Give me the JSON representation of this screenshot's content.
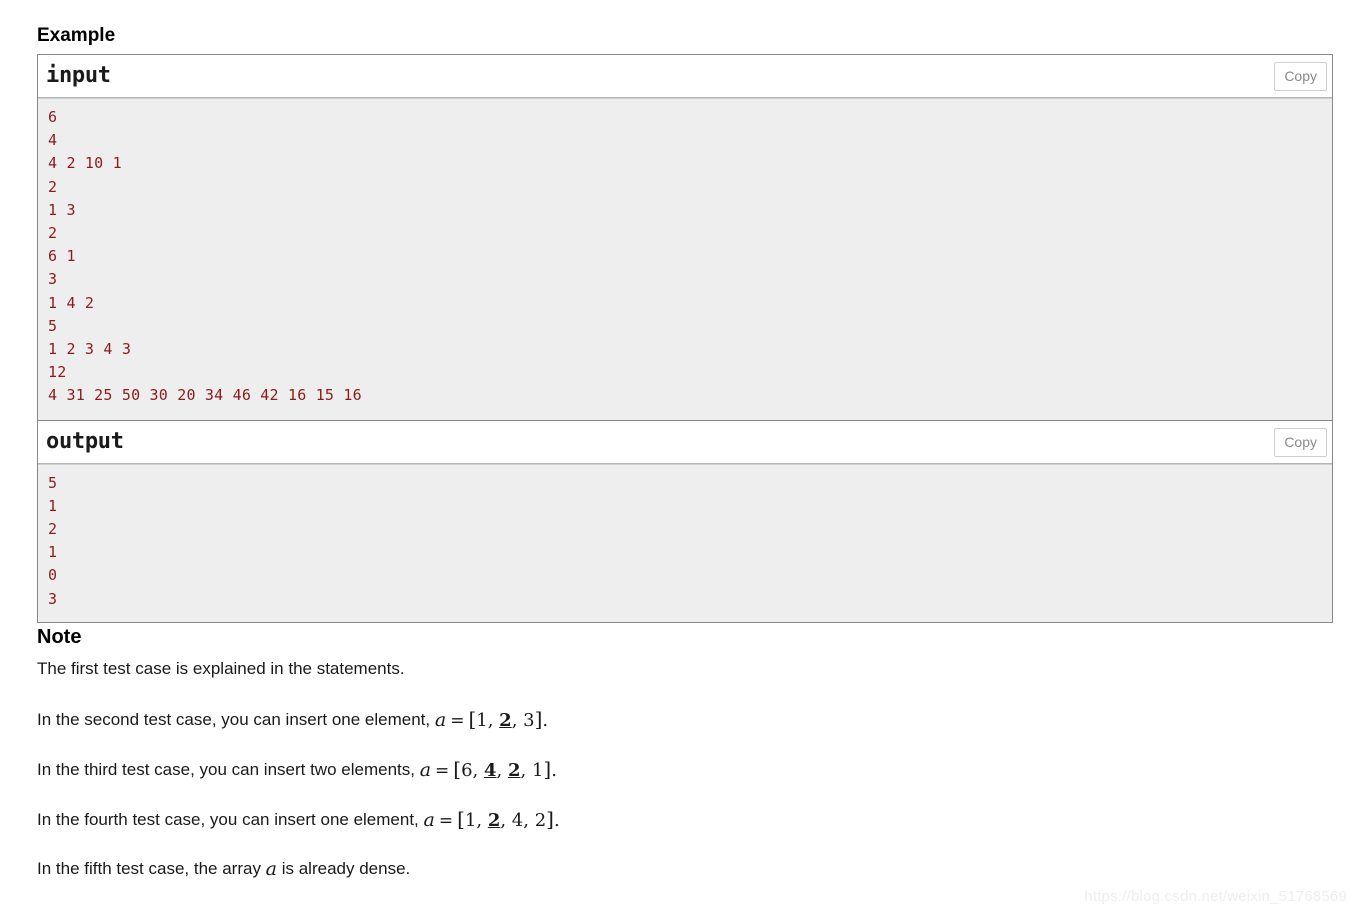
{
  "example": {
    "heading": "Example",
    "input": {
      "label": "input",
      "copy_label": "Copy",
      "text": "6\n4\n4 2 10 1\n2\n1 3\n2\n6 1\n3\n1 4 2\n5\n1 2 3 4 3\n12\n4 31 25 50 30 20 34 46 42 16 15 16"
    },
    "output": {
      "label": "output",
      "copy_label": "Copy",
      "text": "5\n1\n2\n1\n0\n3"
    }
  },
  "note": {
    "heading": "Note",
    "paragraphs": [
      {
        "text": "The first test case is explained in the statements."
      },
      {
        "text": "In the second test case, you can insert one element, "
      },
      {
        "text": "In the third test case, you can insert two elements, "
      },
      {
        "text": "In the fourth test case, you can insert one element, "
      },
      {
        "text": "In the fifth test case, the array "
      }
    ],
    "math": {
      "var": "a",
      "eq": "=",
      "p1": {
        "open": "[",
        "items": [
          "1",
          "2",
          "3"
        ],
        "inserted": [
          false,
          true,
          false
        ],
        "close": "]",
        "period": "."
      },
      "p2": {
        "open": "[",
        "items": [
          "6",
          "4",
          "2",
          "1"
        ],
        "inserted": [
          false,
          true,
          true,
          false
        ],
        "close": "]",
        "period": "."
      },
      "p3": {
        "open": "[",
        "items": [
          "1",
          "2",
          "4",
          "2"
        ],
        "inserted": [
          false,
          true,
          false,
          false
        ],
        "close": "]",
        "period": "."
      },
      "p4_tail": " is already dense."
    }
  },
  "watermark": {
    "text": "https://blog.csdn.net/weixin_51768569"
  },
  "colors": {
    "code_text": "#8f1a1a",
    "code_bg": "#eeeeee",
    "border": "#888888",
    "copy_text": "#8a8a8a",
    "watermark": "#eeeeee"
  }
}
